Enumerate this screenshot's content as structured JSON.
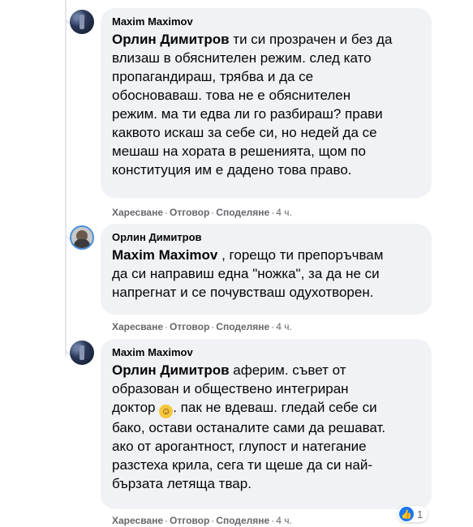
{
  "comments": [
    {
      "author": "Maxim Maximov",
      "mention": "Орлин Димитров",
      "text": " ти си прозрачен и без да\nвлизаш в обяснителен режим. след като\nпропагандираш, трябва и да се\nобосноваваш. това не е обяснителен\nрежим. ма ти едва ли го разбираш? прави\nкаквото искаш за себе си, но недей да се\nмешаш на хората в решенията, щом по\nконституция им е дадено това право.",
      "actions": {
        "like": "Харесване",
        "reply": "Отговор",
        "share": "Споделяне",
        "time": "4 ч."
      }
    },
    {
      "author": "Орлин Димитров",
      "mention": "Maxim Maximov",
      "text": " , горещо ти препоръчвам\nда си направиш една \"ножка\", за да не си\nнапрегнат и се почувстваш одухотворен.",
      "actions": {
        "like": "Харесване",
        "reply": "Отговор",
        "share": "Споделяне",
        "time": "4 ч."
      }
    },
    {
      "author": "Maxim Maximov",
      "mention": "Орлин Димитров",
      "text_a": " аферим. съвет от\nобразован и обществено интегриран\nдоктор ",
      "emoji": "☺",
      "text_b": ". пак не вдеваш. гледай себе си\nбако, остави останалите сами да решават.\nако от арогантност, глупост и натегание\nразстеха крила, сега ти щеше да си най-\nбързата летяща твар.",
      "actions": {
        "like": "Харесване",
        "reply": "Отговор",
        "share": "Споделяне",
        "time": "4 ч."
      },
      "reaction_count": "1"
    }
  ],
  "separator": "·"
}
